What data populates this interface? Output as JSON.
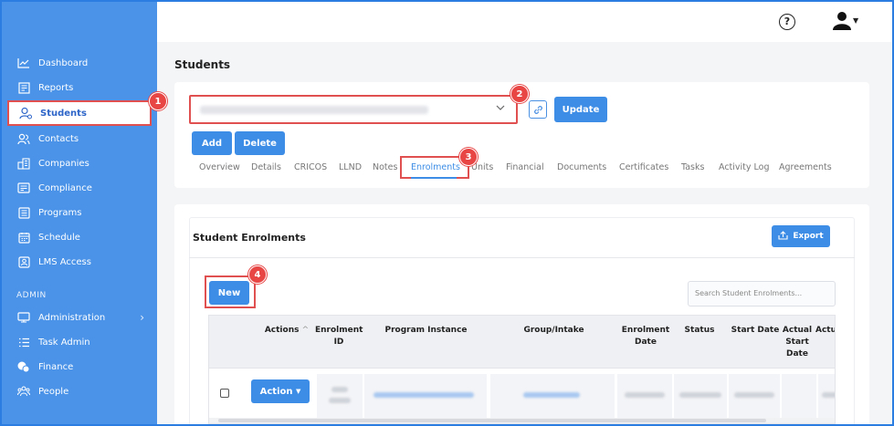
{
  "sidebar": {
    "items": [
      {
        "label": "Dashboard",
        "icon": "chart-line-icon"
      },
      {
        "label": "Reports",
        "icon": "report-icon"
      },
      {
        "label": "Students",
        "icon": "students-icon",
        "active": true
      },
      {
        "label": "Contacts",
        "icon": "contacts-icon"
      },
      {
        "label": "Companies",
        "icon": "companies-icon"
      },
      {
        "label": "Compliance",
        "icon": "compliance-icon"
      },
      {
        "label": "Programs",
        "icon": "programs-icon"
      },
      {
        "label": "Schedule",
        "icon": "schedule-icon"
      },
      {
        "label": "LMS Access",
        "icon": "lms-icon"
      }
    ],
    "admin_label": "ADMIN",
    "admin_items": [
      {
        "label": "Administration",
        "icon": "administration-icon"
      },
      {
        "label": "Task Admin",
        "icon": "task-list-icon"
      },
      {
        "label": "Finance",
        "icon": "finance-icon"
      },
      {
        "label": "People",
        "icon": "people-icon"
      }
    ]
  },
  "header": {
    "help_icon": "help-icon",
    "help_glyph": "?",
    "user_icon": "user-icon"
  },
  "page": {
    "title": "Students"
  },
  "student_form": {
    "update_label": "Update",
    "add_label": "Add",
    "delete_label": "Delete"
  },
  "tabs": [
    {
      "label": "Overview"
    },
    {
      "label": "Details"
    },
    {
      "label": "CRICOS"
    },
    {
      "label": "LLND"
    },
    {
      "label": "Notes"
    },
    {
      "label": "Enrolments",
      "active": true
    },
    {
      "label": "Units"
    },
    {
      "label": "Financial"
    },
    {
      "label": "Documents"
    },
    {
      "label": "Certificates"
    },
    {
      "label": "Tasks"
    },
    {
      "label": "Activity Log"
    },
    {
      "label": "Agreements"
    }
  ],
  "enrolments": {
    "title": "Student Enrolments",
    "export_label": "Export",
    "new_label": "New",
    "search_placeholder": "Search Student Enrolments...",
    "columns": [
      "Actions",
      "Enrolment ID",
      "Program Instance",
      "Group/Intake",
      "Enrolment Date",
      "Status",
      "Start Date",
      "Actual Start Date",
      "Actu D"
    ],
    "action_label": "Action"
  },
  "markers": [
    "1",
    "2",
    "3",
    "4"
  ],
  "colors": {
    "sidebar": "#4a93e8",
    "primary": "#3d8de6",
    "highlight": "#e05050",
    "marker": "#e84545"
  }
}
